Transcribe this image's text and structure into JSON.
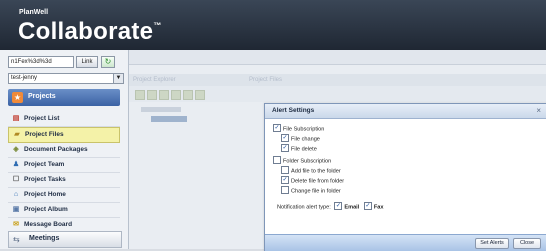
{
  "app": {
    "brand_small_prefix": "PlanWell",
    "brand_title": "Collaborate",
    "brand_tm": "™"
  },
  "sidebar": {
    "url_value": "n1Fex%3d%3d",
    "link_label": "Link",
    "refresh_icon": "refresh-icon",
    "project_select_value": "test-jenny",
    "projects_label": "Projects",
    "items": [
      {
        "label": "Project List",
        "icon": "list-icon"
      },
      {
        "label": "Project Files",
        "icon": "folder-icon",
        "active": true
      },
      {
        "label": "Document Packages",
        "icon": "package-icon"
      },
      {
        "label": "Project Team",
        "icon": "team-icon"
      },
      {
        "label": "Project Tasks",
        "icon": "tasks-icon"
      },
      {
        "label": "Project Home",
        "icon": "home-icon"
      },
      {
        "label": "Project Album",
        "icon": "album-icon"
      },
      {
        "label": "Message Board",
        "icon": "message-icon"
      }
    ],
    "meetings_label": "Meetings"
  },
  "background": {
    "explorer_title": "Project Explorer",
    "files_title": "Project Files"
  },
  "dialog": {
    "title": "Alert Settings",
    "close_icon": "close-icon",
    "file_subscription": {
      "label": "File Subscription",
      "checked": true
    },
    "file_change": {
      "label": "File change",
      "checked": true
    },
    "file_delete": {
      "label": "File delete",
      "checked": true
    },
    "folder_subscription": {
      "label": "Folder Subscription",
      "checked": false
    },
    "add_file": {
      "label": "Add file to the folder",
      "checked": false
    },
    "delete_file": {
      "label": "Delete file from folder",
      "checked": true
    },
    "change_file": {
      "label": "Change file in folder",
      "checked": false
    },
    "notification_label": "Notification alert type:",
    "email": {
      "label": "Email",
      "checked": true
    },
    "fax": {
      "label": "Fax",
      "checked": true
    },
    "set_alerts_label": "Set Alerts",
    "close_label": "Close"
  }
}
